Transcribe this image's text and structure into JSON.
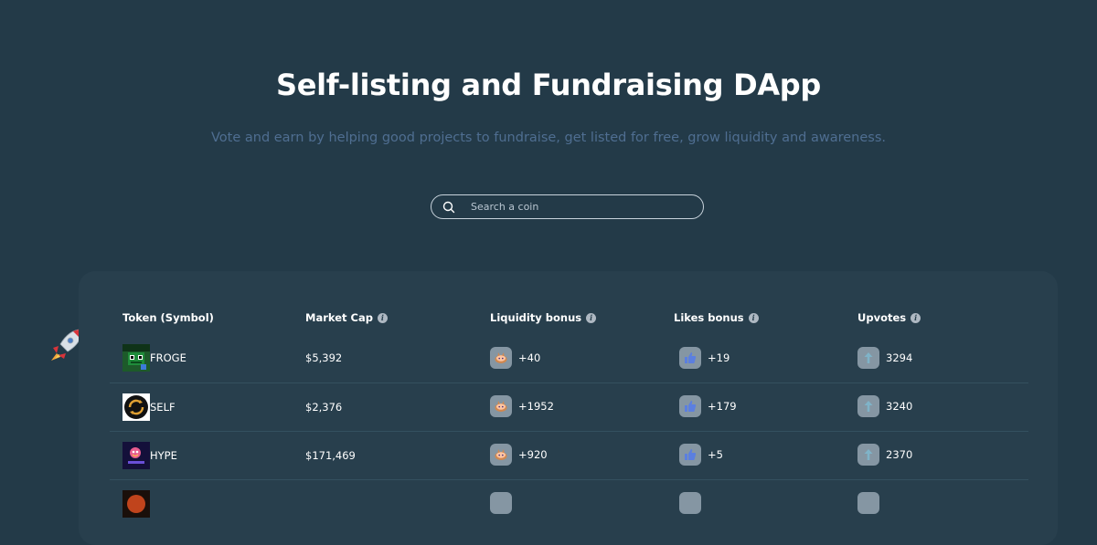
{
  "hero": {
    "title": "Self-listing and Fundraising DApp",
    "subtitle": "Vote and earn by helping good projects to fundraise, get listed for free, grow liquidity and awareness."
  },
  "search": {
    "placeholder": "Search a coin"
  },
  "table": {
    "headers": {
      "token": "Token (Symbol)",
      "market_cap": "Market Cap",
      "liquidity": "Liquidity bonus",
      "likes": "Likes bonus",
      "upvotes": "Upvotes"
    },
    "info_glyph": "i",
    "rows": [
      {
        "symbol": "FROGE",
        "market_cap": "$5,392",
        "liquidity": "+40",
        "likes": "+19",
        "upvotes": "3294"
      },
      {
        "symbol": "SELF",
        "market_cap": "$2,376",
        "liquidity": "+1952",
        "likes": "+179",
        "upvotes": "3240"
      },
      {
        "symbol": "HYPE",
        "market_cap": "$171,469",
        "liquidity": "+920",
        "likes": "+5",
        "upvotes": "2370"
      }
    ]
  },
  "icons": {
    "search": "search-icon",
    "rocket": "rocket-icon",
    "info": "info-icon",
    "liquidity": "pancakeswap-icon",
    "likes": "thumbs-up-icon",
    "upvotes": "arrow-up-icon"
  },
  "colors": {
    "background": "#233a48",
    "panel": "#283f4d",
    "subtitle": "#4f6e91",
    "badge": "#8596a3",
    "thumb": "#5b7fe0",
    "arrow": "#7fb3c8"
  }
}
